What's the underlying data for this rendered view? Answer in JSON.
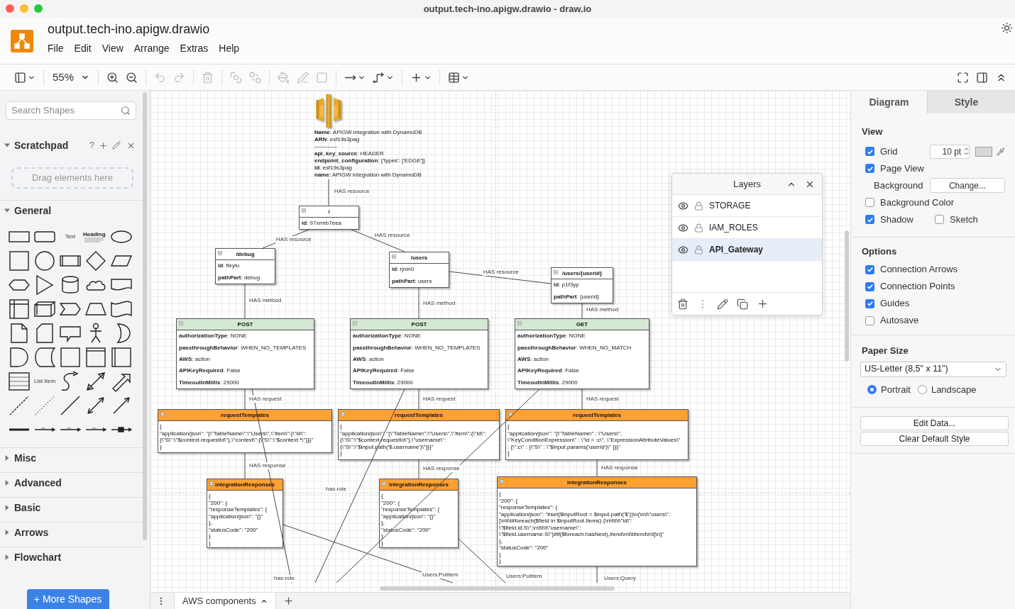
{
  "window": {
    "title": "output.tech-ino.apigw.drawio - draw.io"
  },
  "header": {
    "file_name": "output.tech-ino.apigw.drawio",
    "menu": [
      "File",
      "Edit",
      "View",
      "Arrange",
      "Extras",
      "Help"
    ]
  },
  "toolbar": {
    "zoom": "55%",
    "tools": [
      {
        "disabled": false
      },
      {
        "disabled": false
      },
      {
        "disabled": false
      },
      {
        "disabled": true
      },
      {
        "disabled": true
      },
      {
        "disabled": true
      },
      {
        "disabled": true
      },
      {
        "disabled": true
      },
      {
        "disabled": true
      },
      {
        "disabled": true
      },
      {
        "disabled": true
      },
      {
        "disabled": false
      },
      {
        "disabled": false
      },
      {
        "disabled": false
      },
      {
        "disabled": false
      },
      {
        "disabled": false
      },
      {
        "disabled": false
      },
      {
        "disabled": false
      }
    ]
  },
  "sidebar": {
    "search": {
      "placeholder": "Search Shapes"
    },
    "scratchpad": {
      "title": "Scratchpad",
      "help": "?",
      "hint": "Drag elements here"
    },
    "palette_labels": [
      "Text",
      "Heading",
      "List Item"
    ],
    "sections": [
      {
        "label": "General",
        "expanded": true
      },
      {
        "label": "Misc",
        "expanded": false
      },
      {
        "label": "Advanced",
        "expanded": false
      },
      {
        "label": "Basic",
        "expanded": false
      },
      {
        "label": "Arrows",
        "expanded": false
      },
      {
        "label": "Flowchart",
        "expanded": false
      }
    ],
    "more_shapes": "+ More Shapes"
  },
  "diagram": {
    "nodes": [
      {
        "kind": "api",
        "lines": [
          "**Name**: APIGW integration with DynamoDB",
          "**ARN**: esf19s3pag",
          "------------",
          "**api_key_source**: HEADER",
          "**endpoint_configuration**: {'types': ['EDGE']}",
          "**id**: esf19s3pag",
          "**name**: APIGW integration with DynamoDB"
        ]
      },
      {
        "kind": "fields",
        "title": "/",
        "color": "#ffffff",
        "rows": [
          "**id**: 97xrmb7eea"
        ]
      },
      {
        "kind": "fields",
        "title": "/debug",
        "color": "#ffffff",
        "rows": [
          "**id**: fieylu",
          "**pathPart**: debug"
        ]
      },
      {
        "kind": "fields",
        "title": "/users",
        "color": "#ffffff",
        "rows": [
          "**id**: rjnin0",
          "**pathPart**: users"
        ]
      },
      {
        "kind": "fields",
        "title": "/users/{userid}",
        "color": "#ffffff",
        "rows": [
          "**id**: p1f3yp",
          "**pathPart**: {userid}"
        ]
      },
      {
        "kind": "fields",
        "title": "POST",
        "color": "#d5e8d4",
        "rows": [
          "**authorizationType**: NONE",
          "**passthroughBehavior**: WHEN_NO_TEMPLATES",
          "**AWS**: action",
          "**APIKeyRequired**: False",
          "**TimeoutInMillis**: 29000"
        ]
      },
      {
        "kind": "fields",
        "title": "POST",
        "color": "#d5e8d4",
        "rows": [
          "**authorizationType**: NONE",
          "**passthroughBehavior**: WHEN_NO_TEMPLATES",
          "**AWS**: action",
          "**APIKeyRequired**: False",
          "**TimeoutInMillis**: 29000"
        ]
      },
      {
        "kind": "fields",
        "title": "GET",
        "color": "#d5e8d4",
        "rows": [
          "**authorizationType**: NONE",
          "**passthroughBehavior**: WHEN_NO_MATCH",
          "**AWS**: action",
          "**APIKeyRequired**: False",
          "**TimeoutInMillis**: 29000"
        ]
      },
      {
        "kind": "code",
        "title": "requestTemplates",
        "color": "#ffa033",
        "rows": [
          "{",
          "\"application/json\": \"{\\\"TableName\\\":\\\"Users\\\",\\\"Item\\\":{\\\"id\\\":",
          "{\\\"S\\\":\\\"$context.requestId\\\"},\\\"context\\\":{\\\"S\\\":\\\"$context.*\\\"}}}\"",
          "}"
        ]
      },
      {
        "kind": "code",
        "title": "requestTemplates",
        "color": "#ffa033",
        "rows": [
          "{",
          "\"application/json\": \"{\\\"TableName\\\":\\\"Users\\\",\\\"Item\\\":{\\\"id\\\":",
          "{\\\"S\\\":\\\"$context.requestId\\\"},\\\"username\\\":",
          "{\\\"S\\\":\\\"$input.path('$.username')\\\"}}}\"",
          "}"
        ]
      },
      {
        "kind": "code",
        "title": "requestTemplates",
        "color": "#ffa033",
        "rows": [
          "{",
          "\"application/json\": \"{\\\"TableName\\\" : \\\"Users\\\",",
          "\\\"KeyConditionExpression\\\" : \\\"id = :c\\\", \\\"ExpressionAttributeValues\\\"",
          ": {\\\":c\\\" : {\\\"S\\\" : \\\"$input.params('userid')\\\" }}}\"",
          "}"
        ]
      },
      {
        "kind": "code",
        "title": "integrationResponses",
        "color": "#ffa033",
        "rows": [
          "{",
          "\"200\": {",
          "\"responseTemplates\": {",
          "\"application/json\": \"{}\"",
          "},",
          "\"statusCode\": \"200\"",
          "}",
          "}"
        ]
      },
      {
        "kind": "code",
        "title": "integrationResponses",
        "color": "#ffa033",
        "rows": [
          "{",
          "\"200\": {",
          "\"responseTemplates\": {",
          "\"application/json\": \"{}\"",
          "},",
          "\"statusCode\": \"200\"",
          "}",
          "}"
        ]
      },
      {
        "kind": "code",
        "title": "integrationResponses",
        "color": "#ffa033",
        "rows": [
          "{",
          "\"200\": {",
          "\"responseTemplates\": {",
          "\"application/json\": \"#set($inputRoot = $input.path('$'))\\n{\\n\\t\\\"users\\\":",
          "[\\n\\t\\t#foreach($field in $inputRoot.Items) {\\n\\t\\t\\t\\\"id\\\":",
          "\\\"$field.id.S\\\",\\n\\t\\t\\t\\\"username\\\":",
          "\\\"$field.username.S\\\"}#if($foreach.hasNext),#end\\n\\t\\t#end\\n\\t]\\n}\"",
          "},",
          "\"statusCode\": \"200\"",
          "}",
          "}"
        ]
      }
    ],
    "edge_labels": [
      "HAS resource",
      "HAS resource",
      "HAS resource",
      "HAS resource",
      "HAS method",
      "HAS method",
      "HAS method",
      "HAS request",
      "HAS request",
      "HAS request",
      "HAS response",
      "HAS response",
      "HAS response",
      "has-role",
      "has-role",
      "Users:PutItem",
      "Users:PutItem",
      "Users:Query"
    ]
  },
  "layers": {
    "title": "Layers",
    "items": [
      {
        "name": "STORAGE",
        "selected": false
      },
      {
        "name": "IAM_ROLES",
        "selected": false
      },
      {
        "name": "API_Gateway",
        "selected": true
      }
    ]
  },
  "page_tabs": [
    {
      "label": "AWS components",
      "selected": true
    }
  ],
  "format_panel": {
    "tabs": [
      {
        "label": "Diagram",
        "selected": true
      },
      {
        "label": "Style",
        "selected": false
      }
    ],
    "view": {
      "title": "View",
      "grid": {
        "label": "Grid",
        "checked": true,
        "value": "10 pt"
      },
      "page_view": {
        "label": "Page View",
        "checked": true
      },
      "background": {
        "label": "Background",
        "button": "Change..."
      },
      "background_color": {
        "label": "Background Color",
        "checked": false
      },
      "shadow": {
        "label": "Shadow",
        "checked": true
      },
      "sketch": {
        "label": "Sketch",
        "checked": false
      }
    },
    "options": {
      "title": "Options",
      "items": [
        {
          "label": "Connection Arrows",
          "checked": true
        },
        {
          "label": "Connection Points",
          "checked": true
        },
        {
          "label": "Guides",
          "checked": true
        },
        {
          "label": "Autosave",
          "checked": false
        }
      ]
    },
    "paper": {
      "title": "Paper Size",
      "value": "US-Letter (8,5\" x 11\")",
      "orientations": [
        {
          "label": "Portrait",
          "selected": true
        },
        {
          "label": "Landscape",
          "selected": false
        }
      ]
    },
    "buttons": [
      "Edit Data...",
      "Clear Default Style"
    ]
  }
}
